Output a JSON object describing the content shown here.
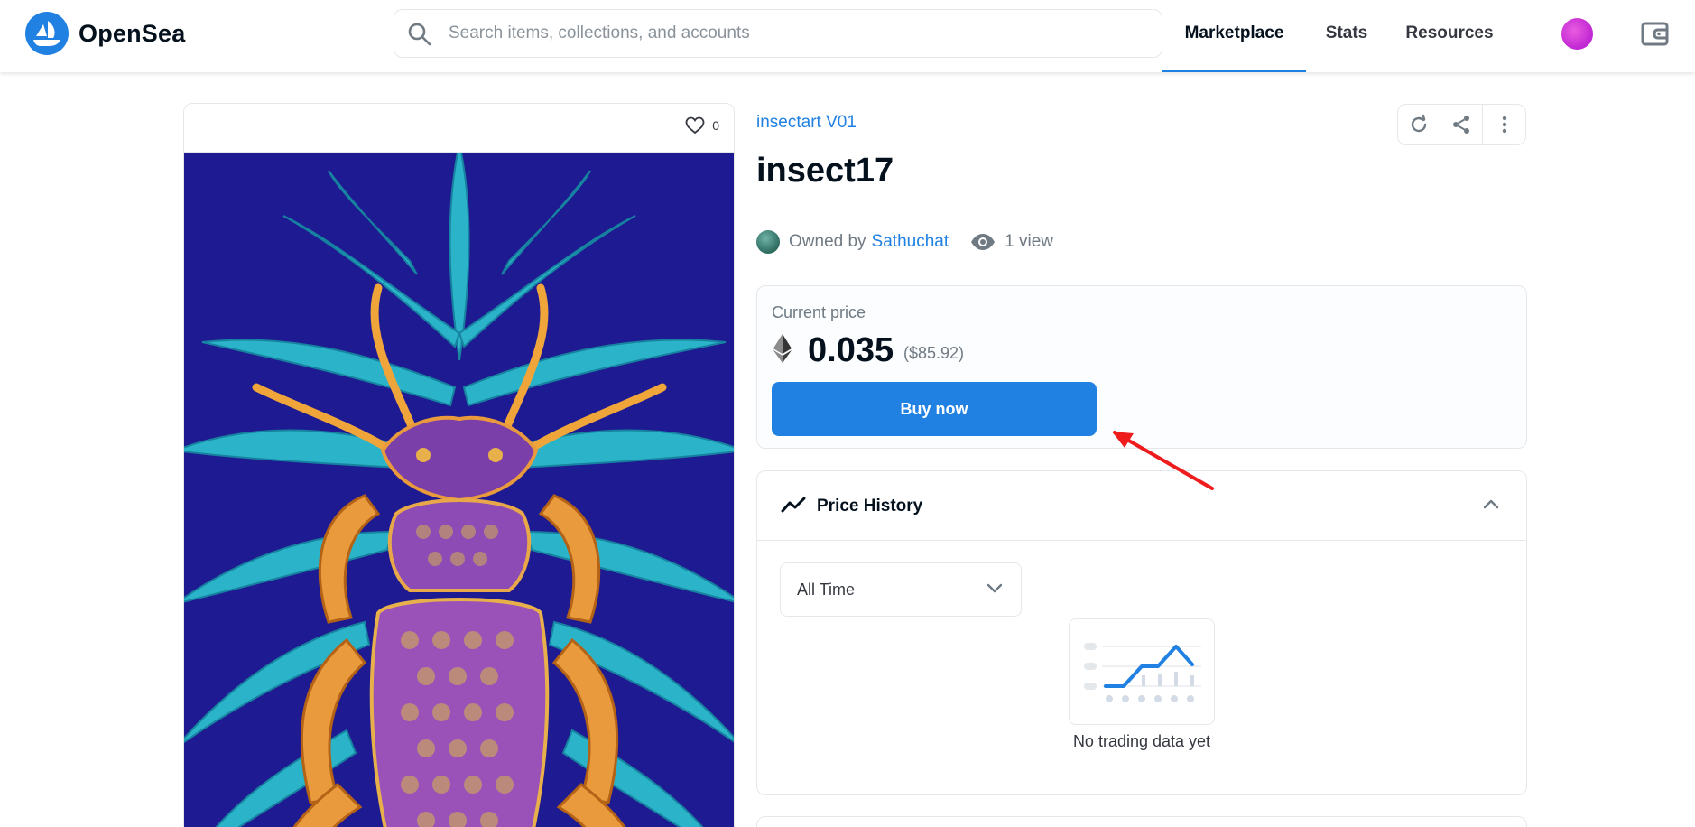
{
  "header": {
    "brand": "OpenSea",
    "search_placeholder": "Search items, collections, and accounts",
    "nav": [
      "Marketplace",
      "Stats",
      "Resources"
    ],
    "active_nav": "Marketplace",
    "accent_color": "#2081e2"
  },
  "item": {
    "favorites_count": "0",
    "collection": "insectart V01",
    "title": "insect17",
    "owned_by_label": "Owned by",
    "owner": "Sathuchat",
    "views": "1 view"
  },
  "price": {
    "label": "Current price",
    "currency_icon": "ethereum-icon",
    "value": "0.035",
    "usd": "($85.92)",
    "buy_label": "Buy now"
  },
  "history": {
    "title": "Price History",
    "range": "All Time",
    "empty_text": "No trading data yet"
  },
  "annotation": {
    "arrow_color": "#ee1c1c"
  }
}
